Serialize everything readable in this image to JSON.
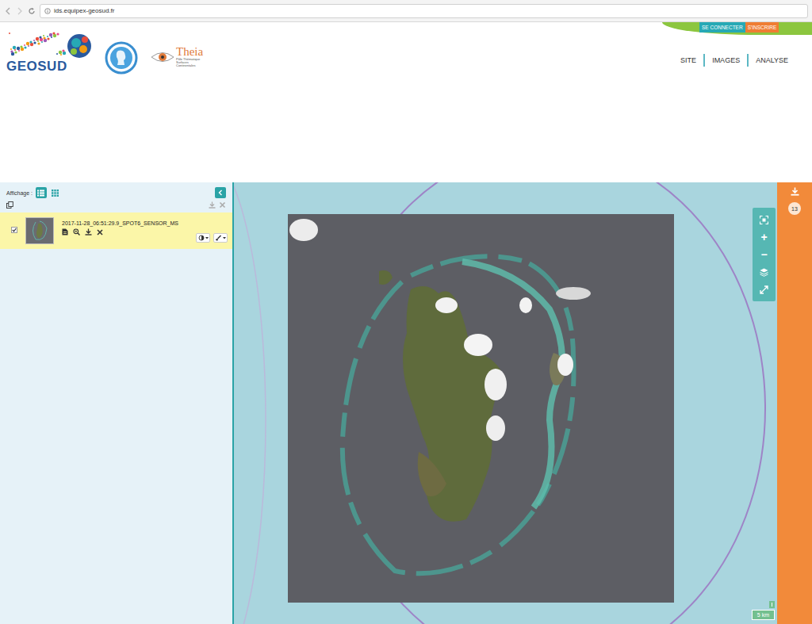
{
  "browser": {
    "url": "ids.equipex-geosud.fr"
  },
  "header": {
    "logos": {
      "geosud": "GEOSUD",
      "theia": "Theia",
      "theia_subtitle": "Pôle Thématique Surfaces Continentales"
    },
    "auth": [
      {
        "label": "SE CONNECTER",
        "color": "#27a9b5"
      },
      {
        "label": "S'INSCRIRE",
        "color": "#ef7d33"
      }
    ],
    "nav": [
      {
        "label": "SITE"
      },
      {
        "label": "IMAGES"
      },
      {
        "label": "ANALYSE"
      }
    ]
  },
  "panel": {
    "display_label": "Affichage :",
    "views": [
      {
        "kind": "list",
        "selected": true
      },
      {
        "kind": "grid",
        "selected": false
      }
    ],
    "layers": [
      {
        "title": "2017-11-28_06:51:29.9_SPOT6_SENSOR_MS",
        "checked": true,
        "selected": true
      }
    ]
  },
  "map": {
    "controls": {
      "zoom_in": "+",
      "zoom_out": "−"
    },
    "scale": "5 km"
  },
  "cart": {
    "count": "13"
  }
}
